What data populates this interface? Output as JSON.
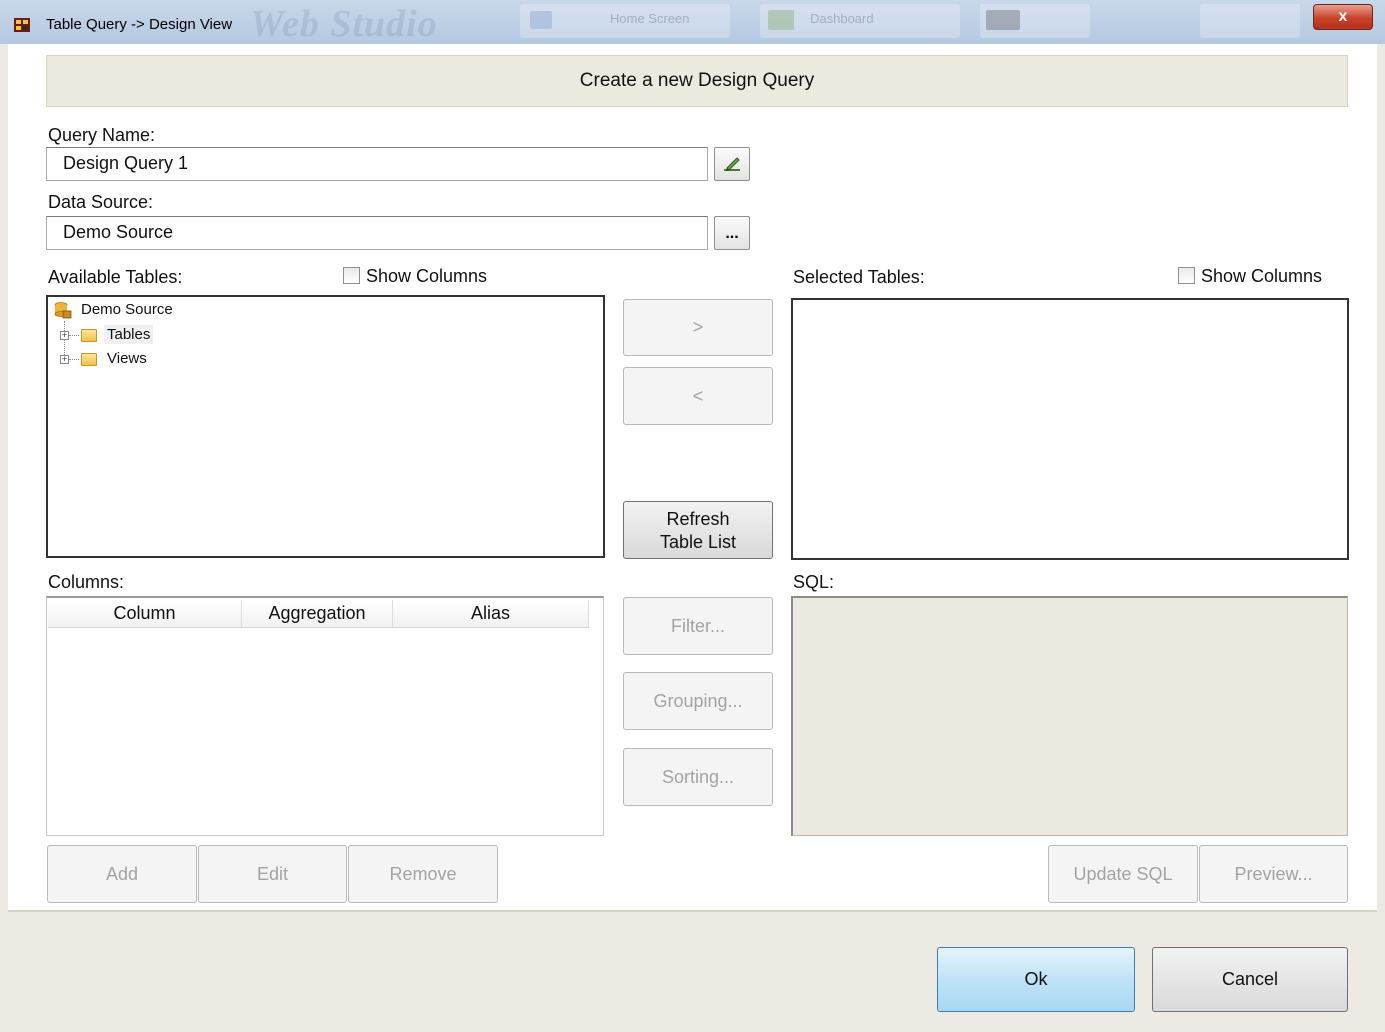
{
  "window": {
    "title": "Table Query -> Design View",
    "close_label": "x",
    "background_app": {
      "logo_text": "Web Studio",
      "tabs": [
        "Home Screen",
        "Dashboard"
      ]
    }
  },
  "header": {
    "title": "Create a new Design Query"
  },
  "query_name": {
    "label": "Query Name:",
    "value": "Design Query 1"
  },
  "data_source": {
    "label": "Data Source:",
    "value": "Demo Source",
    "browse_label": "..."
  },
  "available_tables": {
    "label": "Available Tables:",
    "show_columns_label": "Show Columns",
    "tree": {
      "root": "Demo Source",
      "children": [
        "Tables",
        "Views"
      ]
    }
  },
  "selected_tables": {
    "label": "Selected Tables:",
    "show_columns_label": "Show Columns"
  },
  "transfer": {
    "add_label": ">",
    "remove_label": "<",
    "refresh_label_line1": "Refresh",
    "refresh_label_line2": "Table List"
  },
  "columns": {
    "label": "Columns:",
    "headers": [
      "Column",
      "Aggregation",
      "Alias"
    ],
    "add_label": "Add",
    "edit_label": "Edit",
    "remove_label": "Remove"
  },
  "query_options": {
    "filter_label": "Filter...",
    "grouping_label": "Grouping...",
    "sorting_label": "Sorting..."
  },
  "sql": {
    "label": "SQL:",
    "update_label": "Update SQL",
    "preview_label": "Preview..."
  },
  "footer": {
    "ok_label": "Ok",
    "cancel_label": "Cancel"
  },
  "colors": {
    "accent_ok": "#bfe3f6",
    "header_band": "#eceadf",
    "sql_bg": "#ece9df"
  }
}
